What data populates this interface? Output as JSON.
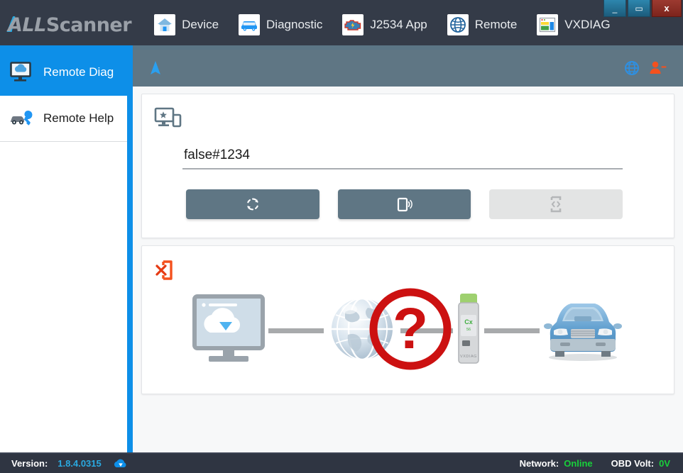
{
  "window": {
    "controls": {
      "minimize": "_",
      "maximize": "▭",
      "close": "x"
    }
  },
  "navbar": {
    "brand_part1": "ALL",
    "brand_part2": "Scanner",
    "items": [
      {
        "label": "Device",
        "icon": "home-icon"
      },
      {
        "label": "Diagnostic",
        "icon": "car-icon"
      },
      {
        "label": "J2534 App",
        "icon": "engine-icon"
      },
      {
        "label": "Remote",
        "icon": "globe-icon"
      },
      {
        "label": "VXDIAG",
        "icon": "window-app-icon"
      }
    ]
  },
  "sidebar": {
    "items": [
      {
        "label": "Remote Diag",
        "icon": "cloud-monitor-icon",
        "active": true
      },
      {
        "label": "Remote Help",
        "icon": "car-wrench-icon",
        "active": false
      }
    ]
  },
  "sub_toolbar": {
    "nav_icon": "navigation-arrow-icon",
    "globe_icon": "globe-icon",
    "logout_icon": "user-minus-icon"
  },
  "remote_panel": {
    "header_icon": "monitor-star-device-icon",
    "session_field": {
      "value": "false#1234",
      "placeholder": ""
    },
    "buttons": [
      {
        "icon": "refresh-icon",
        "name": "refresh-button",
        "disabled": false
      },
      {
        "icon": "device-signal-icon",
        "name": "connect-button",
        "disabled": false
      },
      {
        "icon": "device-code-icon",
        "name": "remote-code-button",
        "disabled": true
      }
    ]
  },
  "status_panel": {
    "status_icon": "device-disconnected-icon",
    "diagram": {
      "nodes": [
        {
          "name": "cloud-monitor",
          "icon": "cloud-monitor-illustration"
        },
        {
          "name": "internet-globe",
          "icon": "globe-illustration"
        },
        {
          "name": "vxdiag-dongle",
          "icon": "vxdiag-dongle-illustration",
          "caption": "VXDIAG"
        },
        {
          "name": "vehicle",
          "icon": "car-illustration"
        }
      ],
      "error_marker": "?"
    }
  },
  "statusbar": {
    "version_label": "Version:",
    "version_value": "1.8.4.0315",
    "download_icon": "cloud-download-icon",
    "network_label": "Network:",
    "network_value": "Online",
    "obd_label": "OBD Volt:",
    "obd_value": "0V"
  },
  "colors": {
    "accent_blue": "#0d8fe8",
    "nav_bg": "#343b48",
    "toolbar_bg": "#5f7684",
    "button_bg": "#5f7684",
    "status_green": "#18d13a",
    "alert_red": "#cc1111",
    "disconnect_orange": "#f4511e"
  }
}
